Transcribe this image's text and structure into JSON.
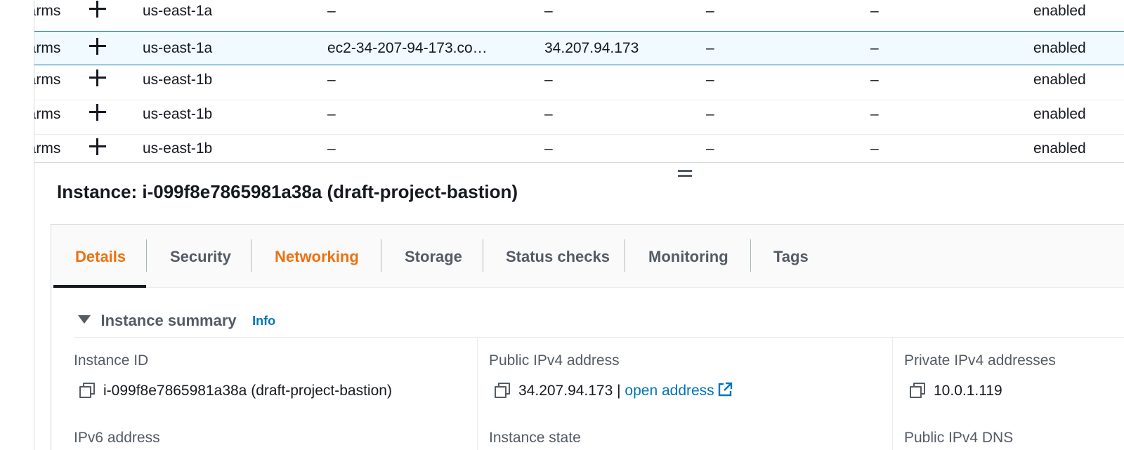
{
  "table": {
    "rows": [
      {
        "alarm": "larms",
        "az": "us-east-1a",
        "dns": "–",
        "ip": "–",
        "d1": "–",
        "d2": "–",
        "monitoring": "enabled"
      },
      {
        "alarm": "larms",
        "az": "us-east-1a",
        "dns": "ec2-34-207-94-173.co…",
        "ip": "34.207.94.173",
        "d1": "–",
        "d2": "–",
        "monitoring": "enabled"
      },
      {
        "alarm": "larms",
        "az": "us-east-1b",
        "dns": "–",
        "ip": "–",
        "d1": "–",
        "d2": "–",
        "monitoring": "enabled"
      },
      {
        "alarm": "larms",
        "az": "us-east-1b",
        "dns": "–",
        "ip": "–",
        "d1": "–",
        "d2": "–",
        "monitoring": "enabled"
      },
      {
        "alarm": "larms",
        "az": "us-east-1b",
        "dns": "–",
        "ip": "–",
        "d1": "–",
        "d2": "–",
        "monitoring": "enabled"
      }
    ]
  },
  "panel": {
    "title": "Instance: i-099f8e7865981a38a (draft-project-bastion)",
    "tabs": [
      {
        "label": "Details"
      },
      {
        "label": "Security"
      },
      {
        "label": "Networking"
      },
      {
        "label": "Storage"
      },
      {
        "label": "Status checks"
      },
      {
        "label": "Monitoring"
      },
      {
        "label": "Tags"
      }
    ],
    "summary": {
      "title": "Instance summary",
      "info": "Info",
      "fields": {
        "instance_id": {
          "label": "Instance ID",
          "value": "i-099f8e7865981a38a (draft-project-bastion)"
        },
        "public_ipv4": {
          "label": "Public IPv4 address",
          "value": "34.207.94.173",
          "separator": " | ",
          "link": "open address"
        },
        "private_ipv4": {
          "label": "Private IPv4 addresses",
          "value": "10.0.1.119"
        },
        "ipv6": {
          "label": "IPv6 address"
        },
        "instance_state": {
          "label": "Instance state"
        },
        "public_dns": {
          "label": "Public IPv4 DNS"
        }
      }
    }
  },
  "colors": {
    "accent_orange": "#ec7211",
    "link_blue": "#0073bb",
    "selected_row_bg": "#f1faff",
    "selected_row_border": "#0073bb"
  },
  "icons": [
    "plus-icon",
    "drag-handle-icon",
    "caret-down-icon",
    "copy-icon",
    "external-link-icon"
  ]
}
